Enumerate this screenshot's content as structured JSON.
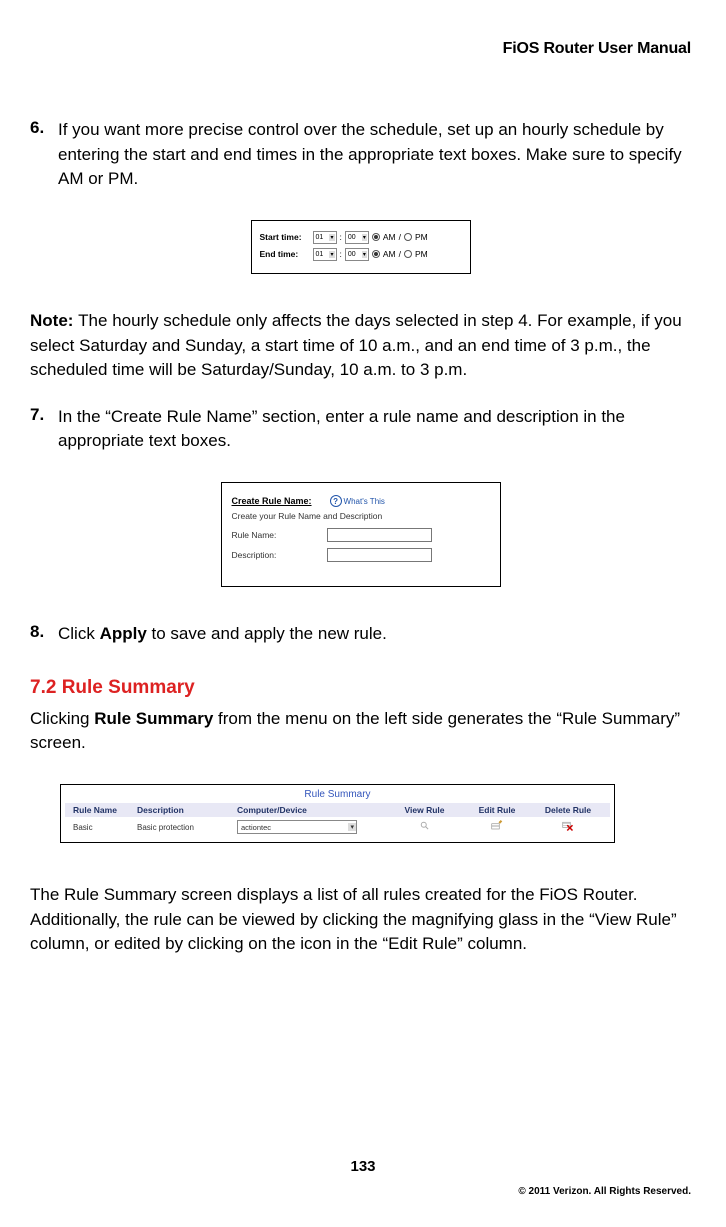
{
  "header": {
    "title": "FiOS Router User Manual"
  },
  "steps": {
    "s6": {
      "num": "6.",
      "text": "If you want more precise control over the schedule, set up an hourly schedule by entering the start and end times in the appropriate text boxes. Make sure to specify AM or PM."
    },
    "s7": {
      "num": "7.",
      "text": "In the “Create Rule Name” section, enter a rule name and description in the appropriate text boxes."
    },
    "s8": {
      "num": "8.",
      "prefix": "Click ",
      "bold": "Apply",
      "suffix": " to save and apply the new rule."
    }
  },
  "time_fig": {
    "start_label": "Start time:",
    "end_label": "End time:",
    "hour": "01",
    "min": "00",
    "am": "AM",
    "pm": "PM"
  },
  "note": {
    "bold": "Note: ",
    "text": "The hourly schedule only affects the days selected in step 4. For example, if you select Saturday and Sunday, a start time of 10 a.m., and an end time of 3 p.m., the scheduled time will be Saturday/Sunday, 10 a.m. to 3 p.m."
  },
  "create_rule_fig": {
    "title": "Create Rule Name:",
    "whats_this": "What's This",
    "sub": "Create your Rule Name and Description",
    "name_label": "Rule Name:",
    "desc_label": "Description:"
  },
  "section": {
    "heading": "7.2  Rule Summary",
    "intro_prefix": "Clicking ",
    "intro_bold": "Rule Summary",
    "intro_suffix": " from the menu on the left side generates the “Rule Summary” screen."
  },
  "rule_summary_fig": {
    "title": "Rule Summary",
    "cols": {
      "name": "Rule Name",
      "desc": "Description",
      "comp": "Computer/Device",
      "view": "View Rule",
      "edit": "Edit Rule",
      "del": "Delete Rule"
    },
    "row": {
      "name": "Basic",
      "desc": "Basic protection",
      "comp": "actiontec"
    }
  },
  "closing_para": "The Rule Summary screen displays a list of all rules created for the FiOS Router. Additionally, the rule can be viewed by clicking the magnifying glass in the “View Rule” column, or edited by clicking on the icon in the “Edit Rule” column.",
  "page_number": "133",
  "copyright": "© 2011 Verizon. All Rights Reserved."
}
